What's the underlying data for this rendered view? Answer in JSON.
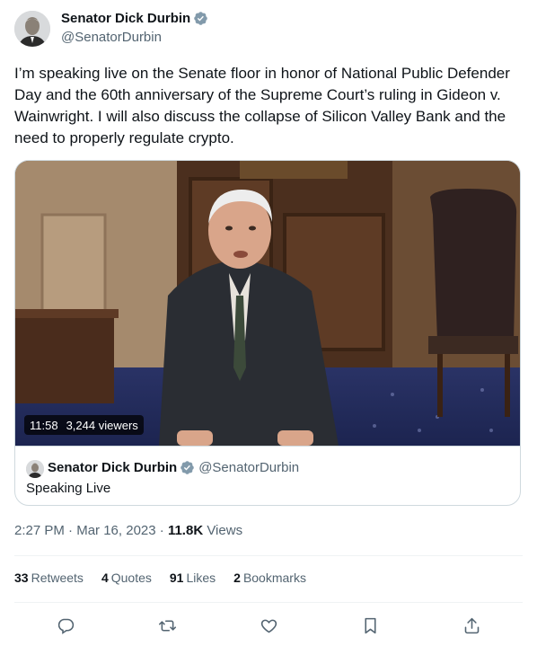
{
  "author": {
    "display_name": "Senator Dick Durbin",
    "handle": "@SenatorDurbin",
    "verified_icon": "verified-badge-icon"
  },
  "tweet": {
    "text": "I’m speaking live on the Senate floor in honor of National Public Defender Day and the 60th anniversary of the Supreme Court’s ruling in Gideon v. Wainwright. I will also discuss the collapse of Silicon Valley Bank and the need to properly regulate crypto."
  },
  "media": {
    "elapsed": "11:58",
    "viewers": "3,244 viewers",
    "card": {
      "display_name": "Senator Dick Durbin",
      "handle": "@SenatorDurbin",
      "status": "Speaking Live"
    }
  },
  "meta": {
    "time": "2:27 PM",
    "separator": "·",
    "date": "Mar 16, 2023",
    "views_count": "11.8K",
    "views_label": "Views"
  },
  "stats": [
    {
      "count": "33",
      "label": "Retweets"
    },
    {
      "count": "4",
      "label": "Quotes"
    },
    {
      "count": "91",
      "label": "Likes"
    },
    {
      "count": "2",
      "label": "Bookmarks"
    }
  ],
  "actions": [
    "reply-icon",
    "retweet-icon",
    "like-icon",
    "bookmark-icon",
    "share-icon"
  ],
  "colors": {
    "text": "#0f1419",
    "secondary": "#536471",
    "verified": "#829aab",
    "border": "#cfd9de"
  }
}
